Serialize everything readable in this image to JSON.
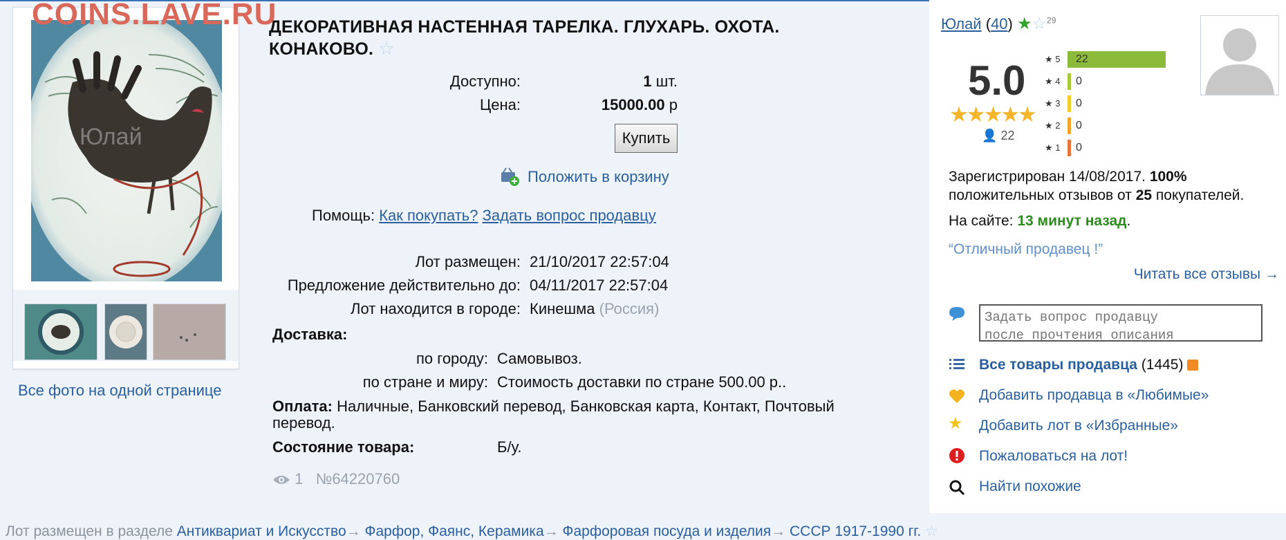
{
  "watermark": "COINS.LAVE.RU",
  "gallery": {
    "photo_watermark": "Юлай",
    "all_photos_link": "Все фото на одной странице"
  },
  "lot": {
    "title_line1": "ДЕКОРАТИВНАЯ НАСТЕННАЯ ТАРЕЛКА. ГЛУХАРЬ. ОХОТА.",
    "title_line2": "КОНАКОВО.",
    "available_label": "Доступно:",
    "available_value": "1",
    "available_unit": "шт.",
    "price_label": "Цена:",
    "price_value": "15000.00",
    "price_currency": "р",
    "buy_button": "Купить",
    "cart_link": "Положить в корзину",
    "help_label": "Помощь:",
    "help_how_to_buy": "Как покупать?",
    "help_ask_seller": "Задать вопрос продавцу",
    "posted_label": "Лот размещен:",
    "posted_value": "21/10/2017 22:57:04",
    "valid_until_label": "Предложение действительно до:",
    "valid_until_value": "04/11/2017 22:57:04",
    "city_label": "Лот находится в городе:",
    "city_value": "Кинешма",
    "country_value": "(Россия)",
    "delivery_label": "Доставка:",
    "delivery_city_label": "по городу:",
    "delivery_city_value": "Самовывоз.",
    "delivery_world_label": "по стране и миру:",
    "delivery_world_value": "Стоимость доставки по стране 500.00 р..",
    "payment_label": "Оплата:",
    "payment_value_line1": "Наличные, Банковский перевод, Банковская карта, Контакт, Почтовый",
    "payment_value_line2": "перевод.",
    "condition_label": "Состояние товара:",
    "condition_value": "Б/у.",
    "views": "1",
    "lot_number": "№64220760"
  },
  "seller": {
    "name": "Юлай",
    "feedback_count": "40",
    "star_count": "29",
    "rating": "5.0",
    "reviewers": "22",
    "histogram": [
      {
        "stars": "5",
        "count": "22",
        "fraction": 1.0,
        "color": "#8cba3a"
      },
      {
        "stars": "4",
        "count": "0",
        "fraction": 0.0,
        "color": "#a8c83a"
      },
      {
        "stars": "3",
        "count": "0",
        "fraction": 0.0,
        "color": "#f2cc2c"
      },
      {
        "stars": "2",
        "count": "0",
        "fraction": 0.0,
        "color": "#f2a52c"
      },
      {
        "stars": "1",
        "count": "0",
        "fraction": 0.0,
        "color": "#e8753a"
      }
    ],
    "registered_text": "Зарегистрирован 14/08/2017.",
    "positive_percent": "100%",
    "positive_text_pre": "положительных отзывов от",
    "positive_buyers": "25",
    "positive_text_post": "покупателей.",
    "online_label": "На сайте:",
    "online_value": "13 минут назад",
    "quote": "“Отличный продавец !”",
    "read_all": "Читать все отзывы →",
    "ask_placeholder": "Задать вопрос продавцу\nпосле прочтения описания",
    "all_items_label": "Все товары продавца",
    "all_items_count": "(1445)",
    "add_favorite_seller": "Добавить продавца в «Любимые»",
    "add_favorite_lot": "Добавить лот в «Избранные»",
    "report_lot": "Пожаловаться на лот!",
    "find_similar": "Найти похожие"
  },
  "breadcrumb": {
    "prefix": "Лот размещен в разделе",
    "items": [
      "Антиквариат и Искусство",
      "Фарфор, Фаянс, Керамика",
      "Фарфоровая посуда и изделия",
      "СССР 1917-1990 гг."
    ]
  },
  "colors": {
    "accent": "#2a5f9e",
    "online_green": "#2e8b1f",
    "rating_star": "#f4b52b"
  }
}
